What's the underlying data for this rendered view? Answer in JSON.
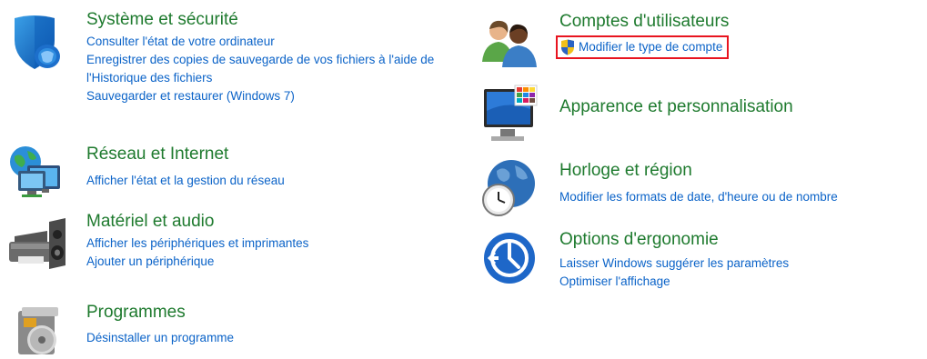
{
  "categories": {
    "system_security": {
      "title": "Système et sécurité",
      "icon": "shield-icon",
      "links": [
        "Consulter l'état de votre ordinateur",
        "Enregistrer des copies de sauvegarde de vos fichiers à l'aide de l'Historique des fichiers",
        "Sauvegarder et restaurer (Windows 7)"
      ]
    },
    "network": {
      "title": "Réseau et Internet",
      "icon": "network-globe-icon",
      "links": [
        "Afficher l'état et la gestion du réseau"
      ]
    },
    "hardware": {
      "title": "Matériel et audio",
      "icon": "printer-speaker-icon",
      "links": [
        "Afficher les périphériques et imprimantes",
        "Ajouter un périphérique"
      ]
    },
    "programs": {
      "title": "Programmes",
      "icon": "programs-disc-icon",
      "links": [
        "Désinstaller un programme"
      ]
    },
    "user_accounts": {
      "title": "Comptes d'utilisateurs",
      "icon": "users-icon",
      "links": [
        "Modifier le type de compte"
      ],
      "highlight_color": "#e8141f"
    },
    "appearance": {
      "title": "Apparence et personnalisation",
      "icon": "monitor-palette-icon",
      "links": []
    },
    "clock_region": {
      "title": "Horloge et région",
      "icon": "clock-globe-icon",
      "links": [
        "Modifier les formats de date, d'heure ou de nombre"
      ]
    },
    "ease_of_access": {
      "title": "Options d'ergonomie",
      "icon": "ease-of-access-icon",
      "links": [
        "Laisser Windows suggérer les paramètres",
        "Optimiser l'affichage"
      ]
    }
  },
  "colors": {
    "category_title": "#1e7a2e",
    "link": "#0b63c8",
    "highlight_border": "#e8141f"
  }
}
